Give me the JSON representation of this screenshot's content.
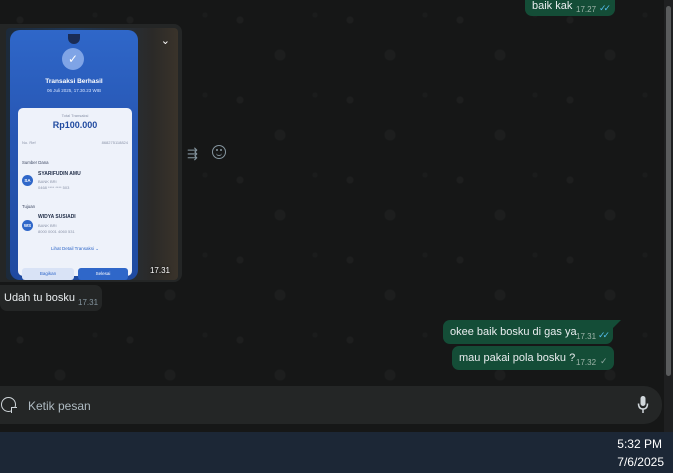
{
  "messages": [
    {
      "text": "baik kak",
      "time": "17.27",
      "status": "read"
    },
    {
      "image": {
        "time": "17.31",
        "screenshot": {
          "title": "Transaksi Berhasil",
          "date": "06 Juli 2025, 17.30.23 WIB",
          "total_label": "Total Transaksi",
          "amount": "Rp100.000",
          "ref_label": "No. Ref",
          "ref_value": "868275118824",
          "source_label": "Sumber Dana",
          "source_initials": "SA",
          "source_name": "SYARIFUDIN AMU",
          "source_bank": "BANK BRI",
          "source_account": "0468 **** **** 503",
          "dest_label": "Tujuan",
          "dest_initials": "WS",
          "dest_name": "WIDYA SUSIADI",
          "dest_bank": "BANK BRI",
          "dest_account": "8000 0001 4060 531",
          "detail_link": "Lihat Detail Transaksi ⌄",
          "share_label": "Bagikan",
          "done_label": "Selesai"
        }
      }
    },
    {
      "text": "Udah tu bosku",
      "time": "17.31"
    },
    {
      "text": "okee baik bosku di gas ya",
      "time": "17.31",
      "status": "read"
    },
    {
      "text": "mau pakai pola bosku ?",
      "time": "17.32",
      "status": "sent"
    }
  ],
  "icons": {
    "ticks_read": "✓✓",
    "tick_sent": "✓",
    "chevron": "⌄",
    "forward": "⇶"
  },
  "composer": {
    "placeholder": "Ketik pesan"
  },
  "taskbar": {
    "time": "5:32 PM",
    "date": "7/6/2025"
  },
  "colors": {
    "outgoing_bubble": "#144d37",
    "incoming_bubble": "#242626",
    "read_tick": "#53bdeb"
  }
}
